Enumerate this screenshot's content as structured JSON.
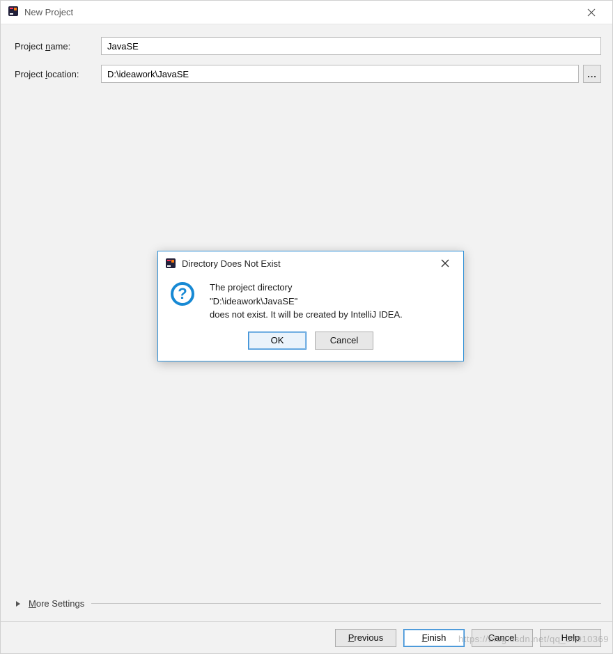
{
  "window": {
    "title": "New Project"
  },
  "form": {
    "project_name_label_pre": "Project ",
    "project_name_mn": "n",
    "project_name_label_post": "ame:",
    "project_name_value": "JavaSE",
    "project_location_label_pre": "Project ",
    "project_location_mn": "l",
    "project_location_label_post": "ocation:",
    "project_location_value": "D:\\ideawork\\JavaSE",
    "browse_label": "..."
  },
  "more": {
    "mn": "M",
    "label_rest": "ore Settings"
  },
  "footer": {
    "previous_mn": "P",
    "previous_rest": "revious",
    "finish_mn": "F",
    "finish_rest": "inish",
    "cancel": "Cancel",
    "help": "Help"
  },
  "modal": {
    "title": "Directory Does Not Exist",
    "line1": "The project directory",
    "line2": "\"D:\\ideawork\\JavaSE\"",
    "line3": "does not exist. It will be created by IntelliJ IDEA.",
    "ok": "OK",
    "cancel": "Cancel",
    "info_glyph": "?"
  },
  "watermark": "https://blog.csdn.net/qq_37910369"
}
